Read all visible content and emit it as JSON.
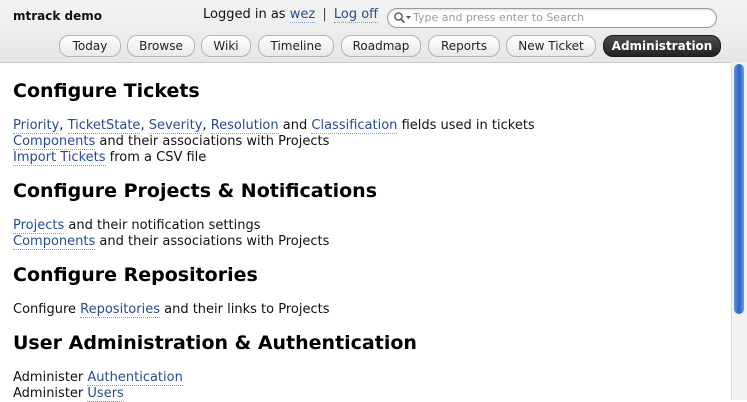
{
  "app": {
    "title": "mtrack demo"
  },
  "login": {
    "prefix": "Logged in as",
    "username": "wez",
    "separator": "|",
    "logoff": "Log off"
  },
  "search": {
    "placeholder": "Type and press enter to Search"
  },
  "tabs": [
    {
      "label": "Today"
    },
    {
      "label": "Browse"
    },
    {
      "label": "Wiki"
    },
    {
      "label": "Timeline"
    },
    {
      "label": "Roadmap"
    },
    {
      "label": "Reports"
    },
    {
      "label": "New Ticket"
    },
    {
      "label": "Administration",
      "active": true
    }
  ],
  "sections": {
    "tickets": {
      "heading": "Configure Tickets",
      "line1": {
        "priority": "Priority",
        "sep1": ",",
        "ticketstate": "TicketState",
        "sep2": ",",
        "severity": "Severity",
        "sep3": ",",
        "resolution": "Resolution",
        "and": "and",
        "classification": "Classification",
        "rest": "fields used in tickets"
      },
      "line2": {
        "components": "Components",
        "rest": "and their associations with Projects"
      },
      "line3": {
        "import": "Import Tickets",
        "rest": "from a CSV file"
      }
    },
    "projects": {
      "heading": "Configure Projects & Notifications",
      "line1": {
        "projects": "Projects",
        "rest": "and their notification settings"
      },
      "line2": {
        "components": "Components",
        "rest": "and their associations with Projects"
      }
    },
    "repos": {
      "heading": "Configure Repositories",
      "line1": {
        "prefix": "Configure",
        "repositories": "Repositories",
        "rest": "and their links to Projects"
      }
    },
    "users": {
      "heading": "User Administration & Authentication",
      "line1": {
        "prefix": "Administer",
        "authentication": "Authentication"
      },
      "line2": {
        "prefix": "Administer",
        "users": "Users"
      }
    }
  },
  "colors": {
    "link": "#2a4b8d",
    "scroll_thumb": "#2d63c8",
    "active_tab": "#222222"
  }
}
